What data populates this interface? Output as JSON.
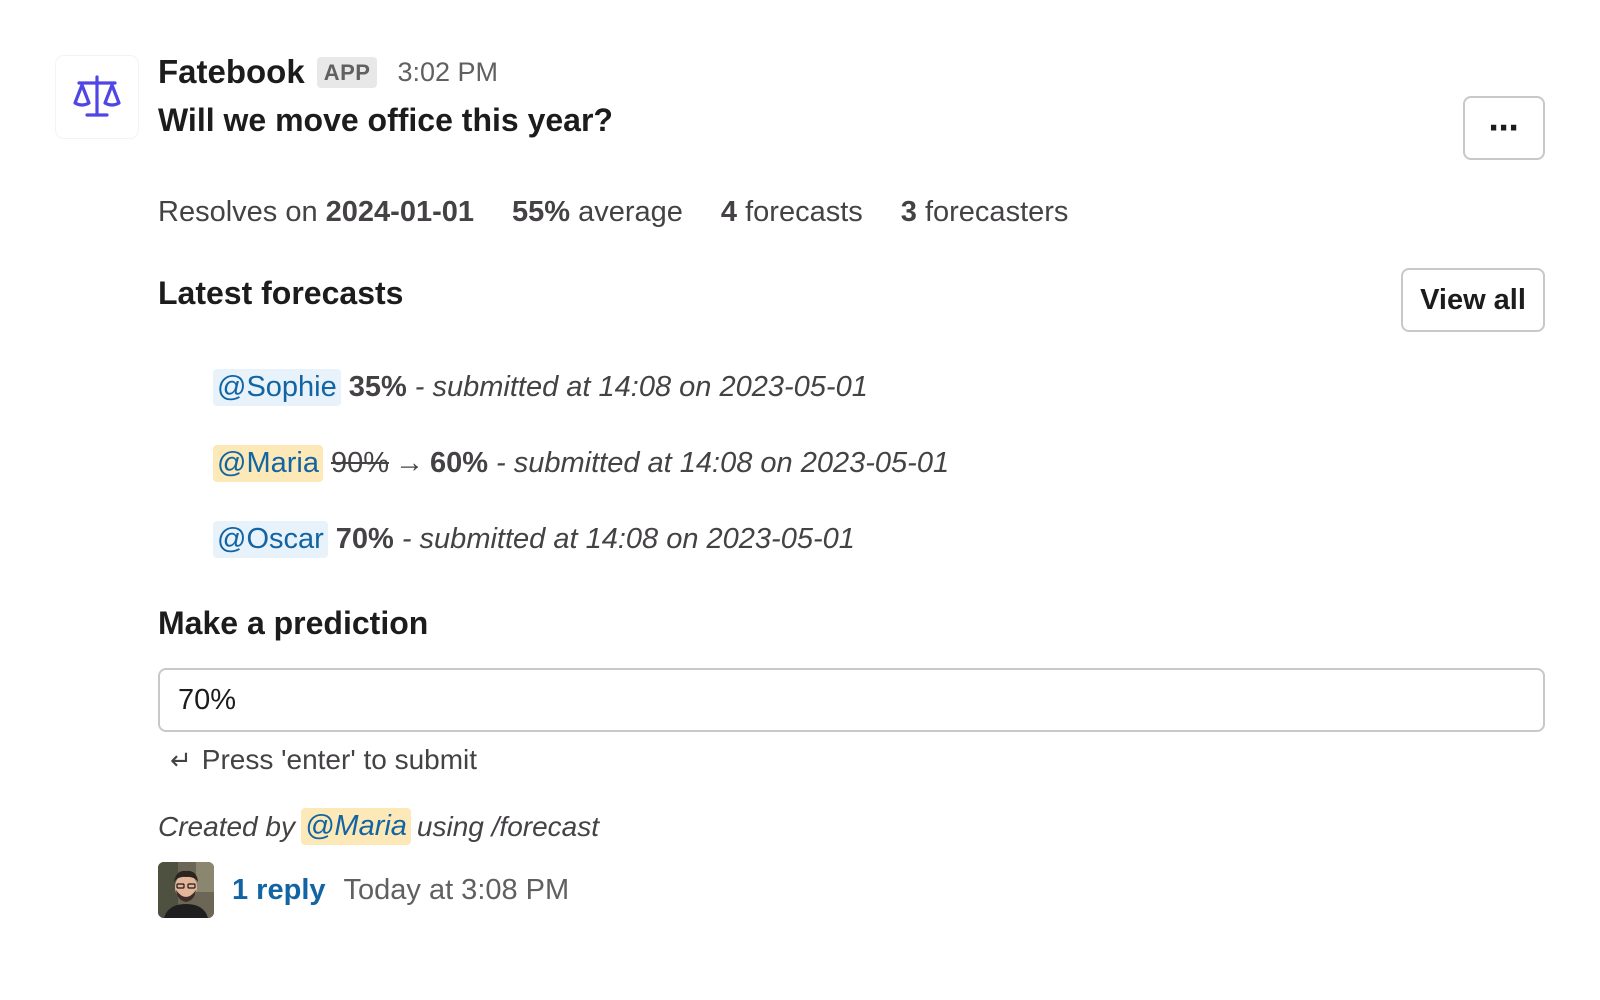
{
  "message": {
    "sender": "Fatebook",
    "badge": "APP",
    "timestamp": "3:02 PM",
    "question": "Will we move office this year?"
  },
  "actions": {
    "more_label": "⋯",
    "view_all_label": "View all"
  },
  "stats": {
    "resolves_prefix": "Resolves on ",
    "resolves_date": "2024-01-01",
    "average_value": "55%",
    "average_label": " average",
    "forecasts_count": "4",
    "forecasts_label": " forecasts",
    "forecasters_count": "3",
    "forecasters_label": " forecasters"
  },
  "latest": {
    "title": "Latest forecasts",
    "items": [
      {
        "user": "@Sophie",
        "previous": "",
        "arrow": "",
        "value": "35%",
        "detail": "- submitted at 14:08 on 2023-05-01"
      },
      {
        "user": "@Maria",
        "previous": "90%",
        "arrow": "→",
        "value": "60%",
        "detail": "- submitted at 14:08 on 2023-05-01"
      },
      {
        "user": "@Oscar",
        "previous": "",
        "arrow": "",
        "value": "70%",
        "detail": "- submitted at 14:08 on 2023-05-01"
      }
    ]
  },
  "prediction": {
    "title": "Make a prediction",
    "input_value": "70%",
    "hint_icon": "↵",
    "hint": "Press 'enter' to submit"
  },
  "footer": {
    "created_prefix": "Created by",
    "created_user": "@Maria",
    "created_suffix": "using /forecast"
  },
  "thread": {
    "reply_label": "1 reply",
    "reply_time": "Today at 3:08 PM"
  },
  "colors": {
    "mention_blue_bg": "#e8f2fb",
    "mention_yellow_bg": "#fce9b7",
    "link": "#1264a3",
    "icon_brand": "#4f46e5"
  }
}
